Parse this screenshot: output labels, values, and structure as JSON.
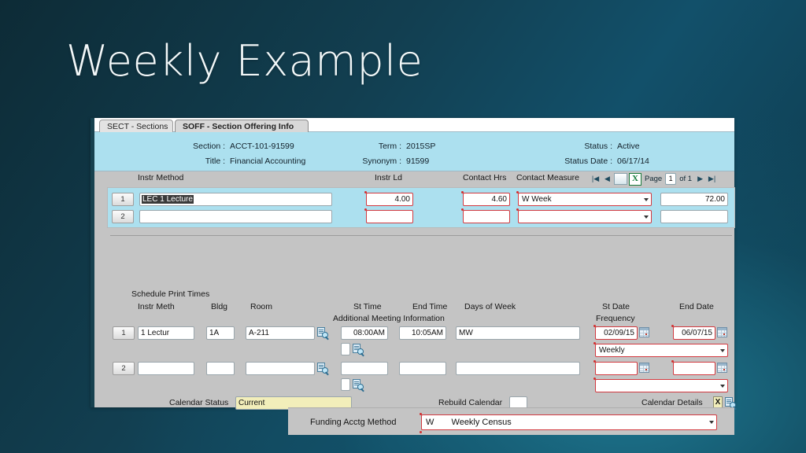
{
  "slide": {
    "title": "Weekly Example"
  },
  "window": {
    "tabs": [
      {
        "label": "SECT - Sections",
        "active": false
      },
      {
        "label": "SOFF - Section Offering Info",
        "active": true
      }
    ],
    "header": {
      "section_label": "Section :",
      "section_value": "ACCT-101-91599",
      "title_label": "Title :",
      "title_value": "Financial Accounting",
      "term_label": "Term :",
      "term_value": "2015SP",
      "synonym_label": "Synonym :",
      "synonym_value": "91599",
      "status_label": "Status :",
      "status_value": "Active",
      "status_date_label": "Status Date :",
      "status_date_value": "06/17/14"
    },
    "instr_grid": {
      "headers": {
        "instr_method": "Instr Method",
        "instr_ld": "Instr Ld",
        "contact_hrs": "Contact Hrs",
        "contact_measure": "Contact Measure"
      },
      "pager": {
        "first": "|◀",
        "prev": "◀",
        "export_icon": "excel-export-icon",
        "page_label": "Page",
        "page_value": "1",
        "of_label": "of 1",
        "next": "▶",
        "last": "▶|"
      },
      "rows": [
        {
          "num": "1",
          "instr_method": "LEC 1 Lecture",
          "instr_method_selected": true,
          "instr_ld": "4.00",
          "contact_hrs": "4.60",
          "contact_measure": "W Week",
          "total": "72.00"
        },
        {
          "num": "2",
          "instr_method": "",
          "instr_method_selected": false,
          "instr_ld": "",
          "contact_hrs": "",
          "contact_measure": "",
          "total": ""
        }
      ]
    },
    "schedule": {
      "section_title": "Schedule Print Times",
      "headers": {
        "instr_meth": "Instr Meth",
        "bldg": "Bldg",
        "room": "Room",
        "st_time": "St Time",
        "end_time": "End Time",
        "additional_meeting": "Additional Meeting Information",
        "days_of_week": "Days of Week",
        "st_date": "St Date",
        "frequency": "Frequency",
        "end_date": "End Date"
      },
      "rows": [
        {
          "num": "1",
          "instr_meth": "1 Lectur",
          "bldg": "1A",
          "room": "A-211",
          "st_time": "08:00AM",
          "end_time": "10:05AM",
          "days_of_week": "MW",
          "st_date": "02/09/15",
          "end_date": "06/07/15",
          "frequency": "Weekly"
        },
        {
          "num": "2",
          "instr_meth": "",
          "bldg": "",
          "room": "",
          "st_time": "",
          "end_time": "",
          "days_of_week": "",
          "st_date": "",
          "end_date": "",
          "frequency": ""
        }
      ]
    },
    "footer": {
      "calendar_status_label": "Calendar Status",
      "calendar_status_value": "Current",
      "rebuild_calendar_label": "Rebuild Calendar",
      "rebuild_calendar_value": "",
      "calendar_details_label": "Calendar Details",
      "calendar_details_flag": "X"
    },
    "funding": {
      "label": "Funding Acctg Method",
      "code": "W",
      "value": "Weekly Census"
    },
    "colors": {
      "slide_bg_dark": "#0d2b36",
      "slide_bg_light": "#12506a",
      "panel_gray": "#c4c4c4",
      "band_blue": "#ace0ef",
      "required_red": "#d2393f",
      "highlight_yellow": "#f2eeba",
      "title_white": "#f3f8f9"
    }
  }
}
